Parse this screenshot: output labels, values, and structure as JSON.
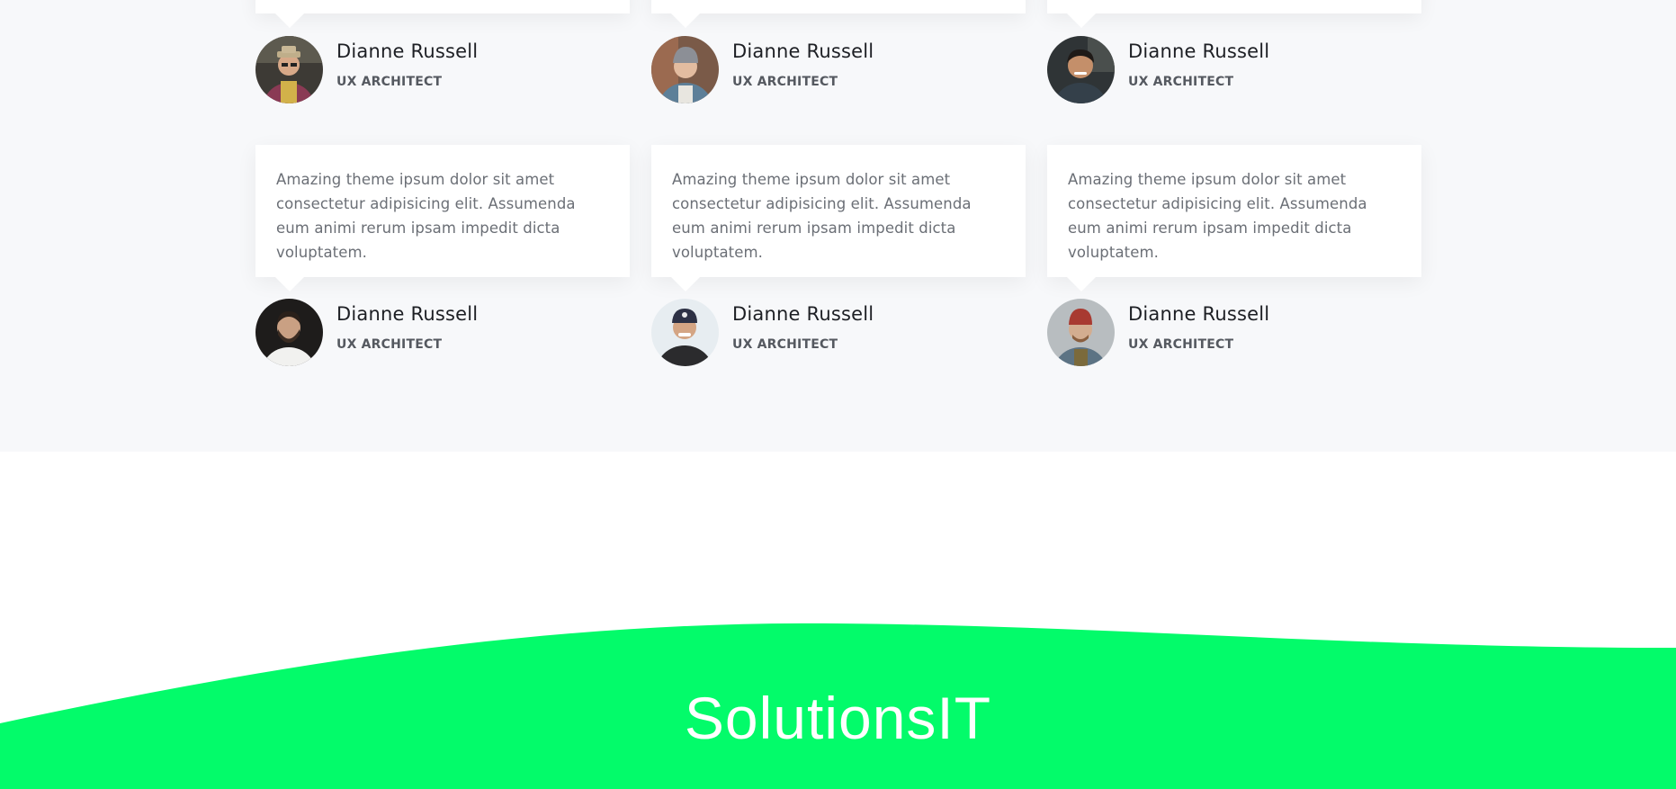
{
  "testimonials": {
    "top_row": [
      {
        "name": "Dianne Russell",
        "role": "UX ARCHITECT",
        "avatar_icon": "avatar-man-hat-scarf"
      },
      {
        "name": "Dianne Russell",
        "role": "UX ARCHITECT",
        "avatar_icon": "avatar-man-beanie"
      },
      {
        "name": "Dianne Russell",
        "role": "UX ARCHITECT",
        "avatar_icon": "avatar-man-smiling-jacket"
      }
    ],
    "bottom_row": [
      {
        "quote": "Amazing theme ipsum dolor sit amet consectetur adipisicing elit. Assumenda eum animi rerum ipsam impedit dicta voluptatem.",
        "name": "Dianne Russell",
        "role": "UX ARCHITECT",
        "avatar_icon": "avatar-man-beard-white-shirt"
      },
      {
        "quote": "Amazing theme ipsum dolor sit amet consectetur adipisicing elit. Assumenda eum animi rerum ipsam impedit dicta voluptatem.",
        "name": "Dianne Russell",
        "role": "UX ARCHITECT",
        "avatar_icon": "avatar-man-cap-smiling"
      },
      {
        "quote": "Amazing theme ipsum dolor sit amet consectetur adipisicing elit. Assumenda eum animi rerum ipsam impedit dicta voluptatem.",
        "name": "Dianne Russell",
        "role": "UX ARCHITECT",
        "avatar_icon": "avatar-man-red-beanie"
      }
    ]
  },
  "footer": {
    "brand": "SolutionsIT",
    "accent_color": "#03fb6a"
  },
  "colors": {
    "section_bg": "#f7f8fa",
    "card_bg": "#ffffff",
    "name_text": "#1d1f24",
    "body_text": "#6b6f76"
  }
}
